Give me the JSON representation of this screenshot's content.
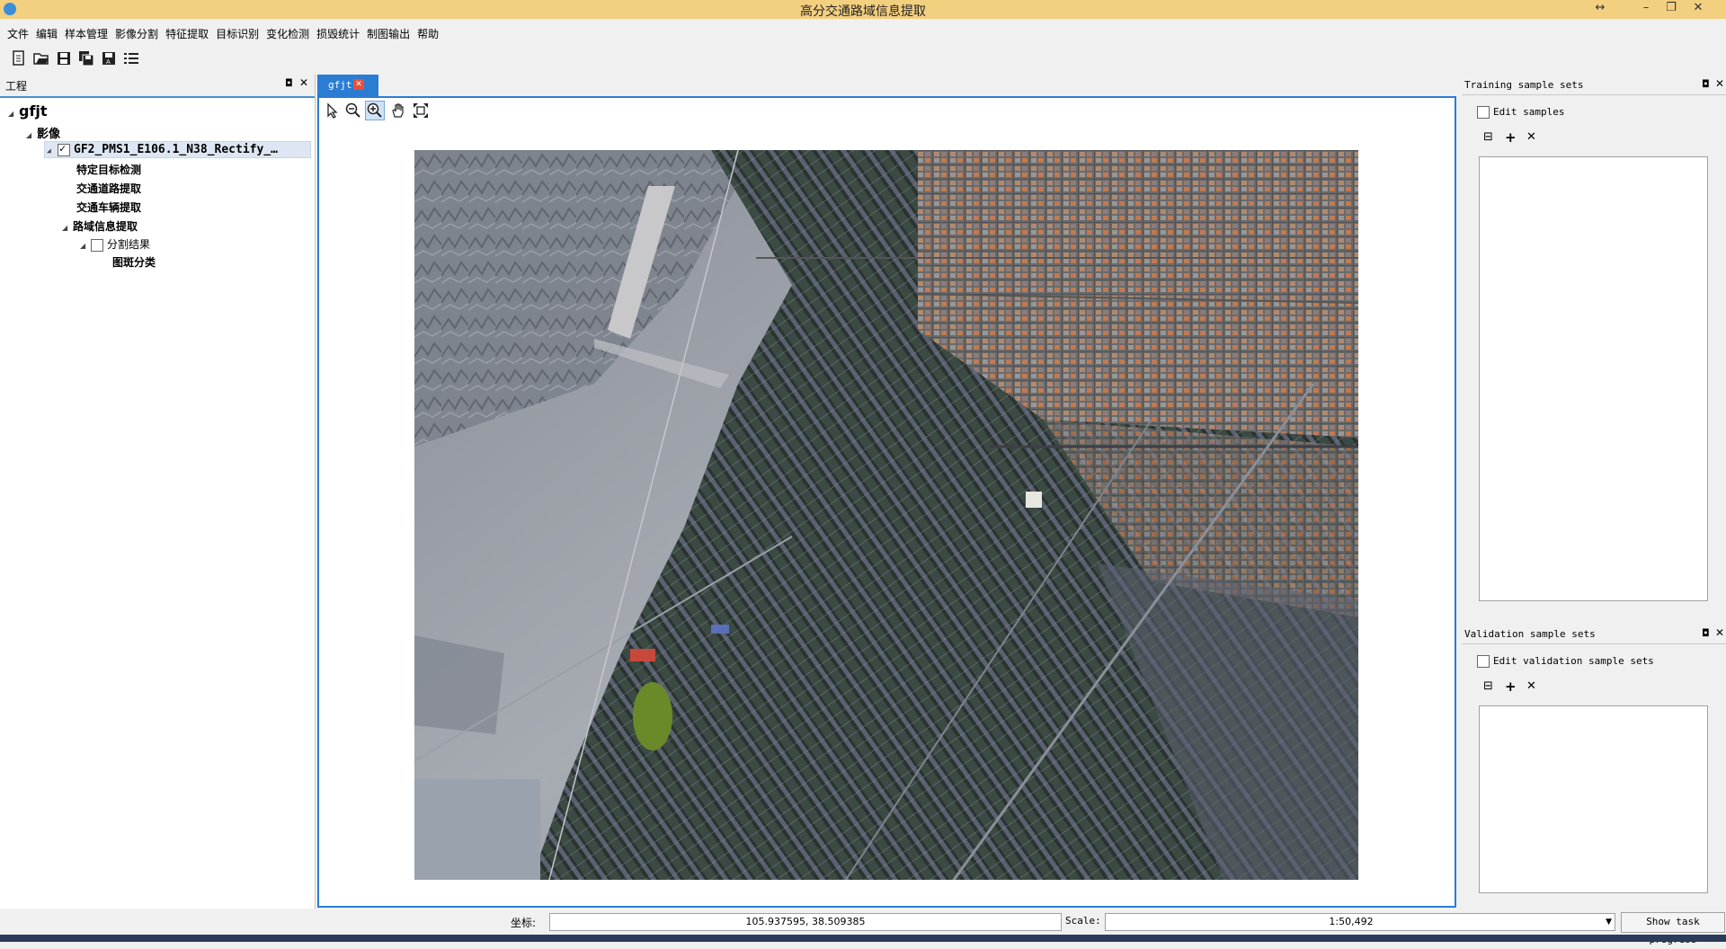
{
  "window": {
    "title": "高分交通路域信息提取"
  },
  "menu": [
    "文件",
    "编辑",
    "样本管理",
    "影像分割",
    "特征提取",
    "目标识别",
    "变化检测",
    "损毁统计",
    "制图输出",
    "帮助"
  ],
  "project": {
    "title": "工程",
    "root": "gfjt",
    "group": "影像",
    "image_layer": "GF2_PMS1_E106.1_N38_Rectify_…",
    "children": [
      "特定目标检测",
      "交通道路提取",
      "交通车辆提取",
      "路域信息提取"
    ],
    "sub_layer": "分割结果",
    "sub_child": "图斑分类"
  },
  "map": {
    "tab_label": "gfjt"
  },
  "training": {
    "title": "Training sample sets",
    "edit_label": "Edit samples"
  },
  "validation": {
    "title": "Validation sample sets",
    "edit_label": "Edit validation sample sets"
  },
  "status": {
    "coord_label": "坐标:",
    "coord_value": "105.937595,  38.509385",
    "scale_label": "Scale:",
    "scale_value": "1:50,492",
    "progress_button": "Show task progress"
  },
  "colors": {
    "accent": "#2b7cd3",
    "titlebar": "#f3cf80"
  }
}
